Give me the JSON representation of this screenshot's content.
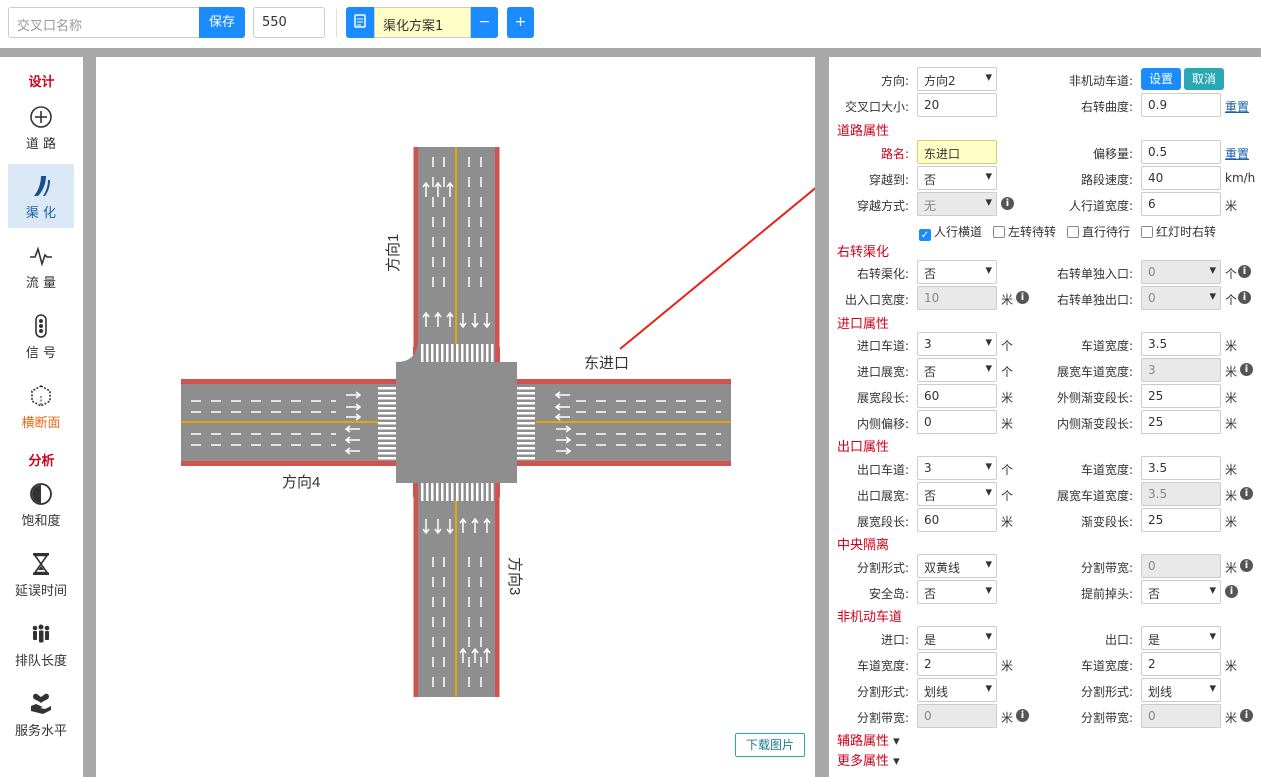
{
  "topbar": {
    "name_placeholder": "交叉口名称",
    "save_label": "保存",
    "size_value": "550",
    "plan_name": "渠化方案1",
    "minus_label": "−",
    "plus_label": "+"
  },
  "sidebar": {
    "design_heading": "设计",
    "analysis_heading": "分析",
    "items": [
      {
        "label": "道 路",
        "icon": "crosshair-icon"
      },
      {
        "label": "渠 化",
        "icon": "channel-icon"
      },
      {
        "label": "流 量",
        "icon": "pulse-icon"
      },
      {
        "label": "信 号",
        "icon": "traffic-light-icon"
      },
      {
        "label": "横断面",
        "icon": "cube-icon"
      },
      {
        "label": "饱和度",
        "icon": "half-circle-icon"
      },
      {
        "label": "延误时间",
        "icon": "hourglass-icon"
      },
      {
        "label": "排队长度",
        "icon": "people-icon"
      },
      {
        "label": "服务水平",
        "icon": "hand-heart-icon"
      }
    ]
  },
  "canvas": {
    "label_dir1": "方向1",
    "label_dir3": "方向3",
    "label_dir4": "方向4",
    "label_east": "东进口",
    "download_label": "下载图片",
    "colors": {
      "road": "#8e8e8e",
      "bike": "#d2524f",
      "center": "#e6a800",
      "swatch_gray": "#999999",
      "swatch_red": "#d2524f",
      "swatch_orange": "#ec5a1c"
    }
  },
  "panel": {
    "direction_label": "方向:",
    "direction_value": "方向2",
    "nonmotor_label": "非机动车道:",
    "set_label": "设置",
    "cancel_label": "取消",
    "size_label": "交叉口大小:",
    "size_value": "20",
    "curve_label": "右转曲度:",
    "curve_value": "0.9",
    "reset_label": "重置",
    "road_section": "道路属性",
    "road_name_label": "路名:",
    "road_name_value": "东进口",
    "offset_label": "偏移量:",
    "offset_value": "0.5",
    "cross_to_label": "穿越到:",
    "cross_to_value": "否",
    "seg_speed_label": "路段速度:",
    "seg_speed_value": "40",
    "seg_speed_unit": "km/h",
    "cross_mode_label": "穿越方式:",
    "cross_mode_value": "无",
    "ped_width_label": "人行道宽度:",
    "ped_width_value": "6",
    "unit_m": "米",
    "unit_ge": "个",
    "cb_crosswalk": "人行横道",
    "cb_left_wait": "左转待转",
    "cb_straight_wait": "直行待行",
    "cb_red_right": "红灯时右转",
    "right_section": "右转渠化",
    "right_ch_label": "右转渠化:",
    "right_ch_value": "否",
    "right_entry_label": "右转单独入口:",
    "right_entry_value": "0",
    "io_width_label": "出入口宽度:",
    "io_width_value": "10",
    "right_exit_label": "右转单独出口:",
    "right_exit_value": "0",
    "entry_section": "进口属性",
    "entry_lanes_label": "进口车道:",
    "entry_lanes_value": "3",
    "lane_width_label": "车道宽度:",
    "entry_lane_width": "3.5",
    "entry_widen_label": "进口展宽:",
    "entry_widen_value": "否",
    "widen_lane_width_label": "展宽车道宽度:",
    "entry_widen_lane_width": "3",
    "widen_len_label": "展宽段长:",
    "entry_widen_len": "60",
    "outer_grad_label": "外侧渐变段长:",
    "outer_grad_value": "25",
    "inner_offset_label": "内侧偏移:",
    "inner_offset_value": "0",
    "inner_grad_label": "内侧渐变段长:",
    "inner_grad_value": "25",
    "exit_section": "出口属性",
    "exit_lanes_label": "出口车道:",
    "exit_lanes_value": "3",
    "exit_lane_width": "3.5",
    "exit_widen_label": "出口展宽:",
    "exit_widen_value": "否",
    "exit_widen_lane_width": "3.5",
    "exit_widen_len": "60",
    "grad_len_label": "渐变段长:",
    "grad_len_value": "25",
    "median_section": "中央隔离",
    "split_form_label": "分割形式:",
    "median_form_value": "双黄线",
    "split_width_label": "分割带宽:",
    "median_width_value": "0",
    "island_label": "安全岛:",
    "island_value": "否",
    "uturn_label": "提前掉头:",
    "uturn_value": "否",
    "bike_section": "非机动车道",
    "bike_in_label": "进口:",
    "bike_in_value": "是",
    "bike_out_label": "出口:",
    "bike_out_value": "是",
    "bike_in_width": "2",
    "bike_out_width": "2",
    "bike_in_form": "划线",
    "bike_out_form": "划线",
    "bike_in_split": "0",
    "bike_out_split": "0",
    "aux_section": "辅路属性",
    "more_section": "更多属性"
  }
}
